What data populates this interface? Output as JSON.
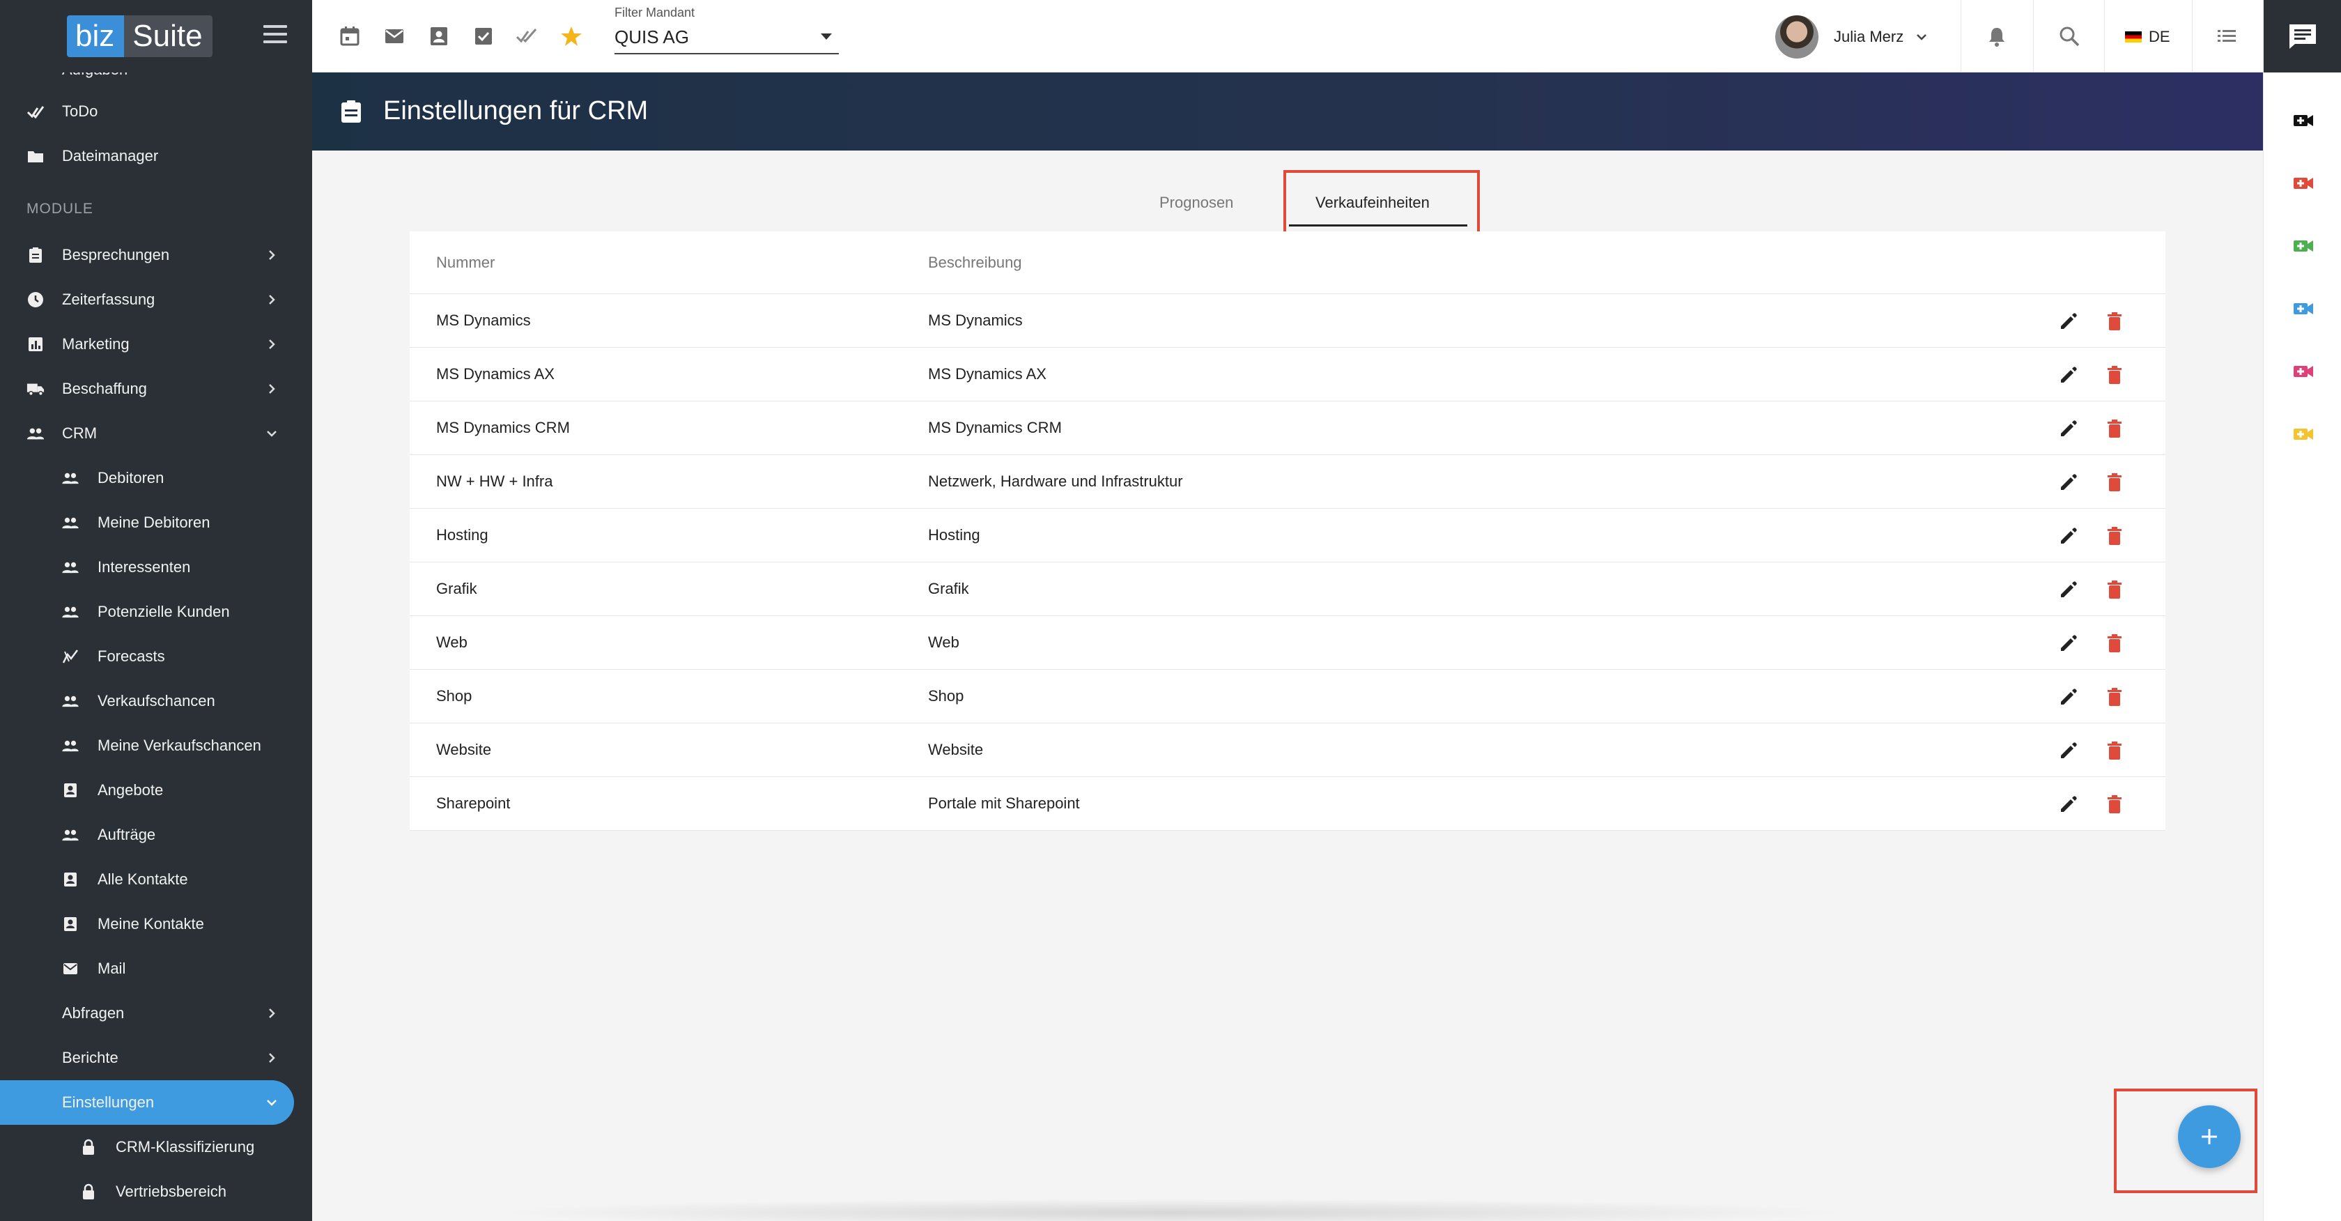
{
  "app": {
    "logo_biz": "biz",
    "logo_suite": "Suite"
  },
  "sidebar": {
    "partial_item": "Aufgaben",
    "items_top": [
      {
        "label": "ToDo",
        "icon": "check-icon"
      },
      {
        "label": "Dateimanager",
        "icon": "folder-icon"
      }
    ],
    "section_label": "MODULE",
    "modules": [
      {
        "label": "Besprechungen",
        "icon": "clipboard-icon"
      },
      {
        "label": "Zeiterfassung",
        "icon": "clock-icon"
      },
      {
        "label": "Marketing",
        "icon": "chart-icon"
      },
      {
        "label": "Beschaffung",
        "icon": "truck-icon"
      },
      {
        "label": "CRM",
        "icon": "people-icon"
      }
    ],
    "crm_items": [
      {
        "label": "Debitoren",
        "icon": "people-icon"
      },
      {
        "label": "Meine Debitoren",
        "icon": "people-icon"
      },
      {
        "label": "Interessenten",
        "icon": "people-icon"
      },
      {
        "label": "Potenzielle Kunden",
        "icon": "people-icon"
      },
      {
        "label": "Forecasts",
        "icon": "forecast-icon"
      },
      {
        "label": "Verkaufschancen",
        "icon": "people-icon"
      },
      {
        "label": "Meine Verkaufschancen",
        "icon": "people-icon"
      },
      {
        "label": "Angebote",
        "icon": "contact-card-icon"
      },
      {
        "label": "Aufträge",
        "icon": "people-icon"
      },
      {
        "label": "Alle Kontakte",
        "icon": "contact-card-icon"
      },
      {
        "label": "Meine Kontakte",
        "icon": "contact-card-icon"
      },
      {
        "label": "Mail",
        "icon": "mail-icon"
      }
    ],
    "crm_groups": [
      {
        "label": "Abfragen"
      },
      {
        "label": "Berichte"
      },
      {
        "label": "Einstellungen"
      }
    ],
    "settings_items": [
      {
        "label": "CRM-Klassifizierung",
        "icon": "lock-icon"
      },
      {
        "label": "Vertriebsbereich",
        "icon": "lock-icon"
      }
    ]
  },
  "topbar": {
    "filter_label": "Filter Mandant",
    "filter_value": "QUIS AG",
    "user_name": "Julia Merz",
    "language": "DE"
  },
  "header": {
    "title": "Einstellungen für CRM"
  },
  "tabs": [
    {
      "label": "Prognosen",
      "active": false
    },
    {
      "label": "Verkaufeinheiten",
      "active": true
    }
  ],
  "table": {
    "columns": [
      "Nummer",
      "Beschreibung"
    ],
    "rows": [
      [
        "MS Dynamics",
        "MS Dynamics"
      ],
      [
        "MS Dynamics AX",
        "MS Dynamics AX"
      ],
      [
        "MS Dynamics CRM",
        "MS Dynamics CRM"
      ],
      [
        "NW + HW + Infra",
        "Netzwerk, Hardware und Infrastruktur"
      ],
      [
        "Hosting",
        "Hosting"
      ],
      [
        "Grafik",
        "Grafik"
      ],
      [
        "Web",
        "Web"
      ],
      [
        "Shop",
        "Shop"
      ],
      [
        "Website",
        "Website"
      ],
      [
        "Sharepoint",
        "Portale mit Sharepoint"
      ]
    ]
  },
  "colors": {
    "sidebar_bg": "#2b2f36",
    "accent": "#3f9be0",
    "delete": "#e04a3a",
    "star": "#f4b41a",
    "highlight_box": "#e04a3a"
  },
  "rail_icons": [
    {
      "name": "video-add-icon",
      "color": "#111111"
    },
    {
      "name": "video-add-icon",
      "color": "#e04a3a"
    },
    {
      "name": "video-add-icon",
      "color": "#4caf50"
    },
    {
      "name": "video-add-icon",
      "color": "#3f9be0"
    },
    {
      "name": "video-add-icon",
      "color": "#e0407a"
    },
    {
      "name": "video-add-icon",
      "color": "#f4c430"
    }
  ]
}
